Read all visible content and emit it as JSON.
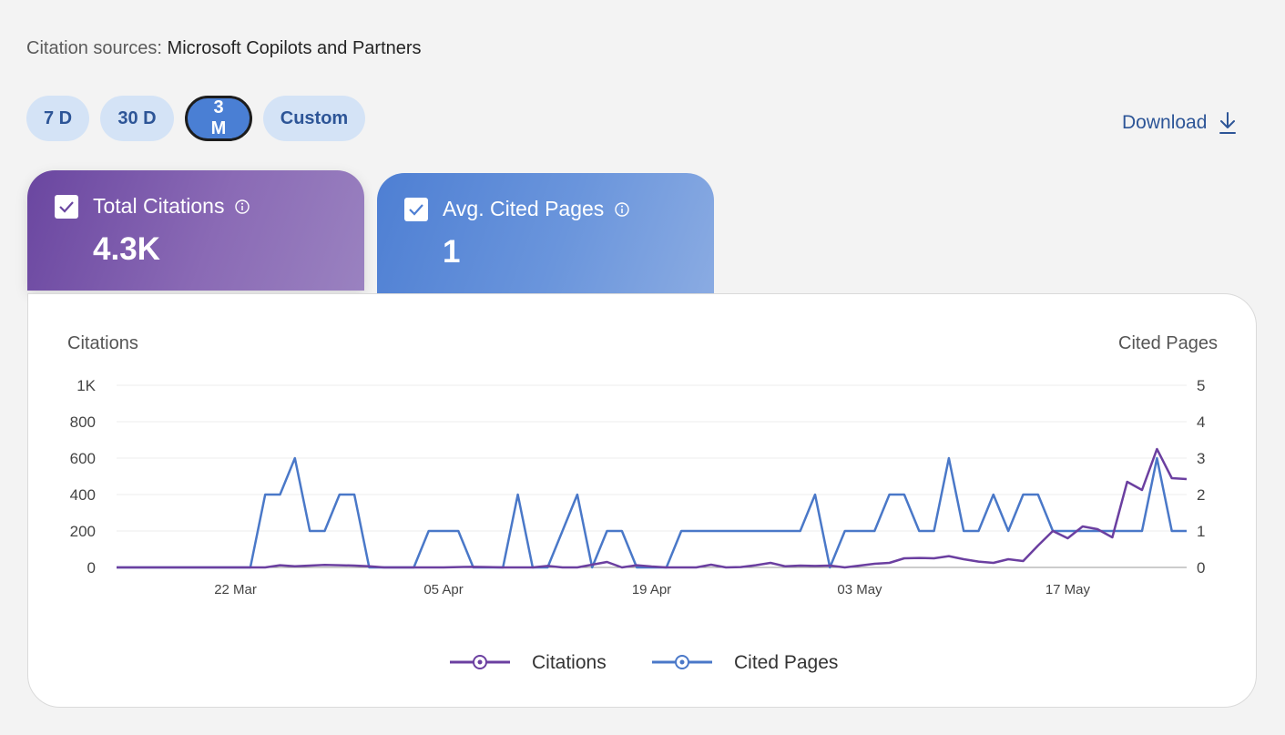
{
  "header": {
    "source_label": "Citation sources:",
    "source_value": "Microsoft Copilots and Partners"
  },
  "ranges": [
    {
      "label": "7 D",
      "active": false
    },
    {
      "label": "30 D",
      "active": false
    },
    {
      "label": "3 M",
      "active": true
    },
    {
      "label": "Custom",
      "active": false
    }
  ],
  "download": {
    "label": "Download",
    "icon": "download-icon"
  },
  "cards": {
    "citations": {
      "label": "Total Citations",
      "value": "4.3K",
      "checked": true
    },
    "pages": {
      "label": "Avg. Cited Pages",
      "value": "1",
      "checked": true
    }
  },
  "colors": {
    "citations": "#6b3fa0",
    "pages": "#4a78c8",
    "accent": "#2d5597"
  },
  "chart_data": {
    "type": "line",
    "left_axis_title": "Citations",
    "right_axis_title": "Cited Pages",
    "left_ticks": [
      "0",
      "200",
      "400",
      "600",
      "800",
      "1K"
    ],
    "right_ticks": [
      "0",
      "1",
      "2",
      "3",
      "4",
      "5"
    ],
    "ylim_left": [
      0,
      1000
    ],
    "ylim_right": [
      0,
      5
    ],
    "x_tick_labels": [
      {
        "label": "22 Mar",
        "index": 8
      },
      {
        "label": "05 Apr",
        "index": 22
      },
      {
        "label": "19 Apr",
        "index": 36
      },
      {
        "label": "03 May",
        "index": 50
      },
      {
        "label": "17 May",
        "index": 64
      }
    ],
    "series": [
      {
        "name": "Citations",
        "axis": "left",
        "values": [
          0,
          0,
          0,
          0,
          0,
          0,
          0,
          0,
          0,
          0,
          0,
          12,
          6,
          10,
          14,
          12,
          10,
          6,
          0,
          0,
          0,
          0,
          0,
          2,
          3,
          2,
          0,
          0,
          0,
          8,
          0,
          0,
          15,
          30,
          0,
          12,
          5,
          0,
          0,
          0,
          15,
          0,
          2,
          12,
          25,
          6,
          10,
          8,
          10,
          0,
          10,
          20,
          25,
          50,
          52,
          50,
          62,
          45,
          32,
          25,
          45,
          35,
          120,
          200,
          160,
          225,
          210,
          165,
          470,
          425,
          650,
          490,
          485
        ]
      },
      {
        "name": "Cited Pages",
        "axis": "right",
        "values": [
          0,
          0,
          0,
          0,
          0,
          0,
          0,
          0,
          0,
          0,
          2,
          2,
          3,
          1,
          1,
          2,
          2,
          0,
          0,
          0,
          0,
          1,
          1,
          1,
          0,
          0,
          0,
          2,
          0,
          0,
          1,
          2,
          0,
          1,
          1,
          0,
          0,
          0,
          1,
          1,
          1,
          1,
          1,
          1,
          1,
          1,
          1,
          2,
          0,
          1,
          1,
          1,
          2,
          2,
          1,
          1,
          3,
          1,
          1,
          2,
          1,
          2,
          2,
          1,
          1,
          1,
          1,
          1,
          1,
          1,
          3,
          1,
          1
        ]
      }
    ]
  }
}
